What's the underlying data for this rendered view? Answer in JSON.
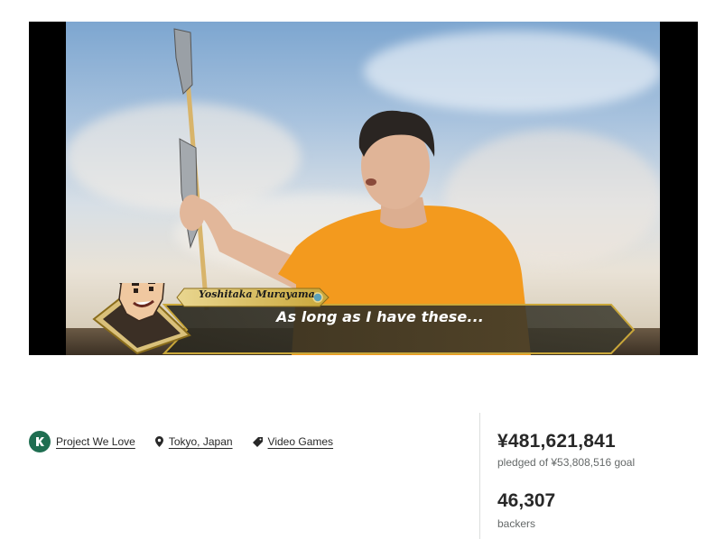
{
  "video": {
    "speaker": "Yoshitaka Murayama",
    "subtitle": "As long as I have these..."
  },
  "meta": {
    "badge_label": "Project We Love",
    "location": "Tokyo, Japan",
    "category": "Video Games"
  },
  "stats": {
    "pledged_amount": "¥481,621,841",
    "pledged_caption": "pledged of ¥53,808,516 goal",
    "backers_count": "46,307",
    "backers_caption": "backers"
  },
  "colors": {
    "badge": "#1f6e51",
    "shirt": "#f39a1e",
    "dialog_gold": "#c9a73a"
  }
}
